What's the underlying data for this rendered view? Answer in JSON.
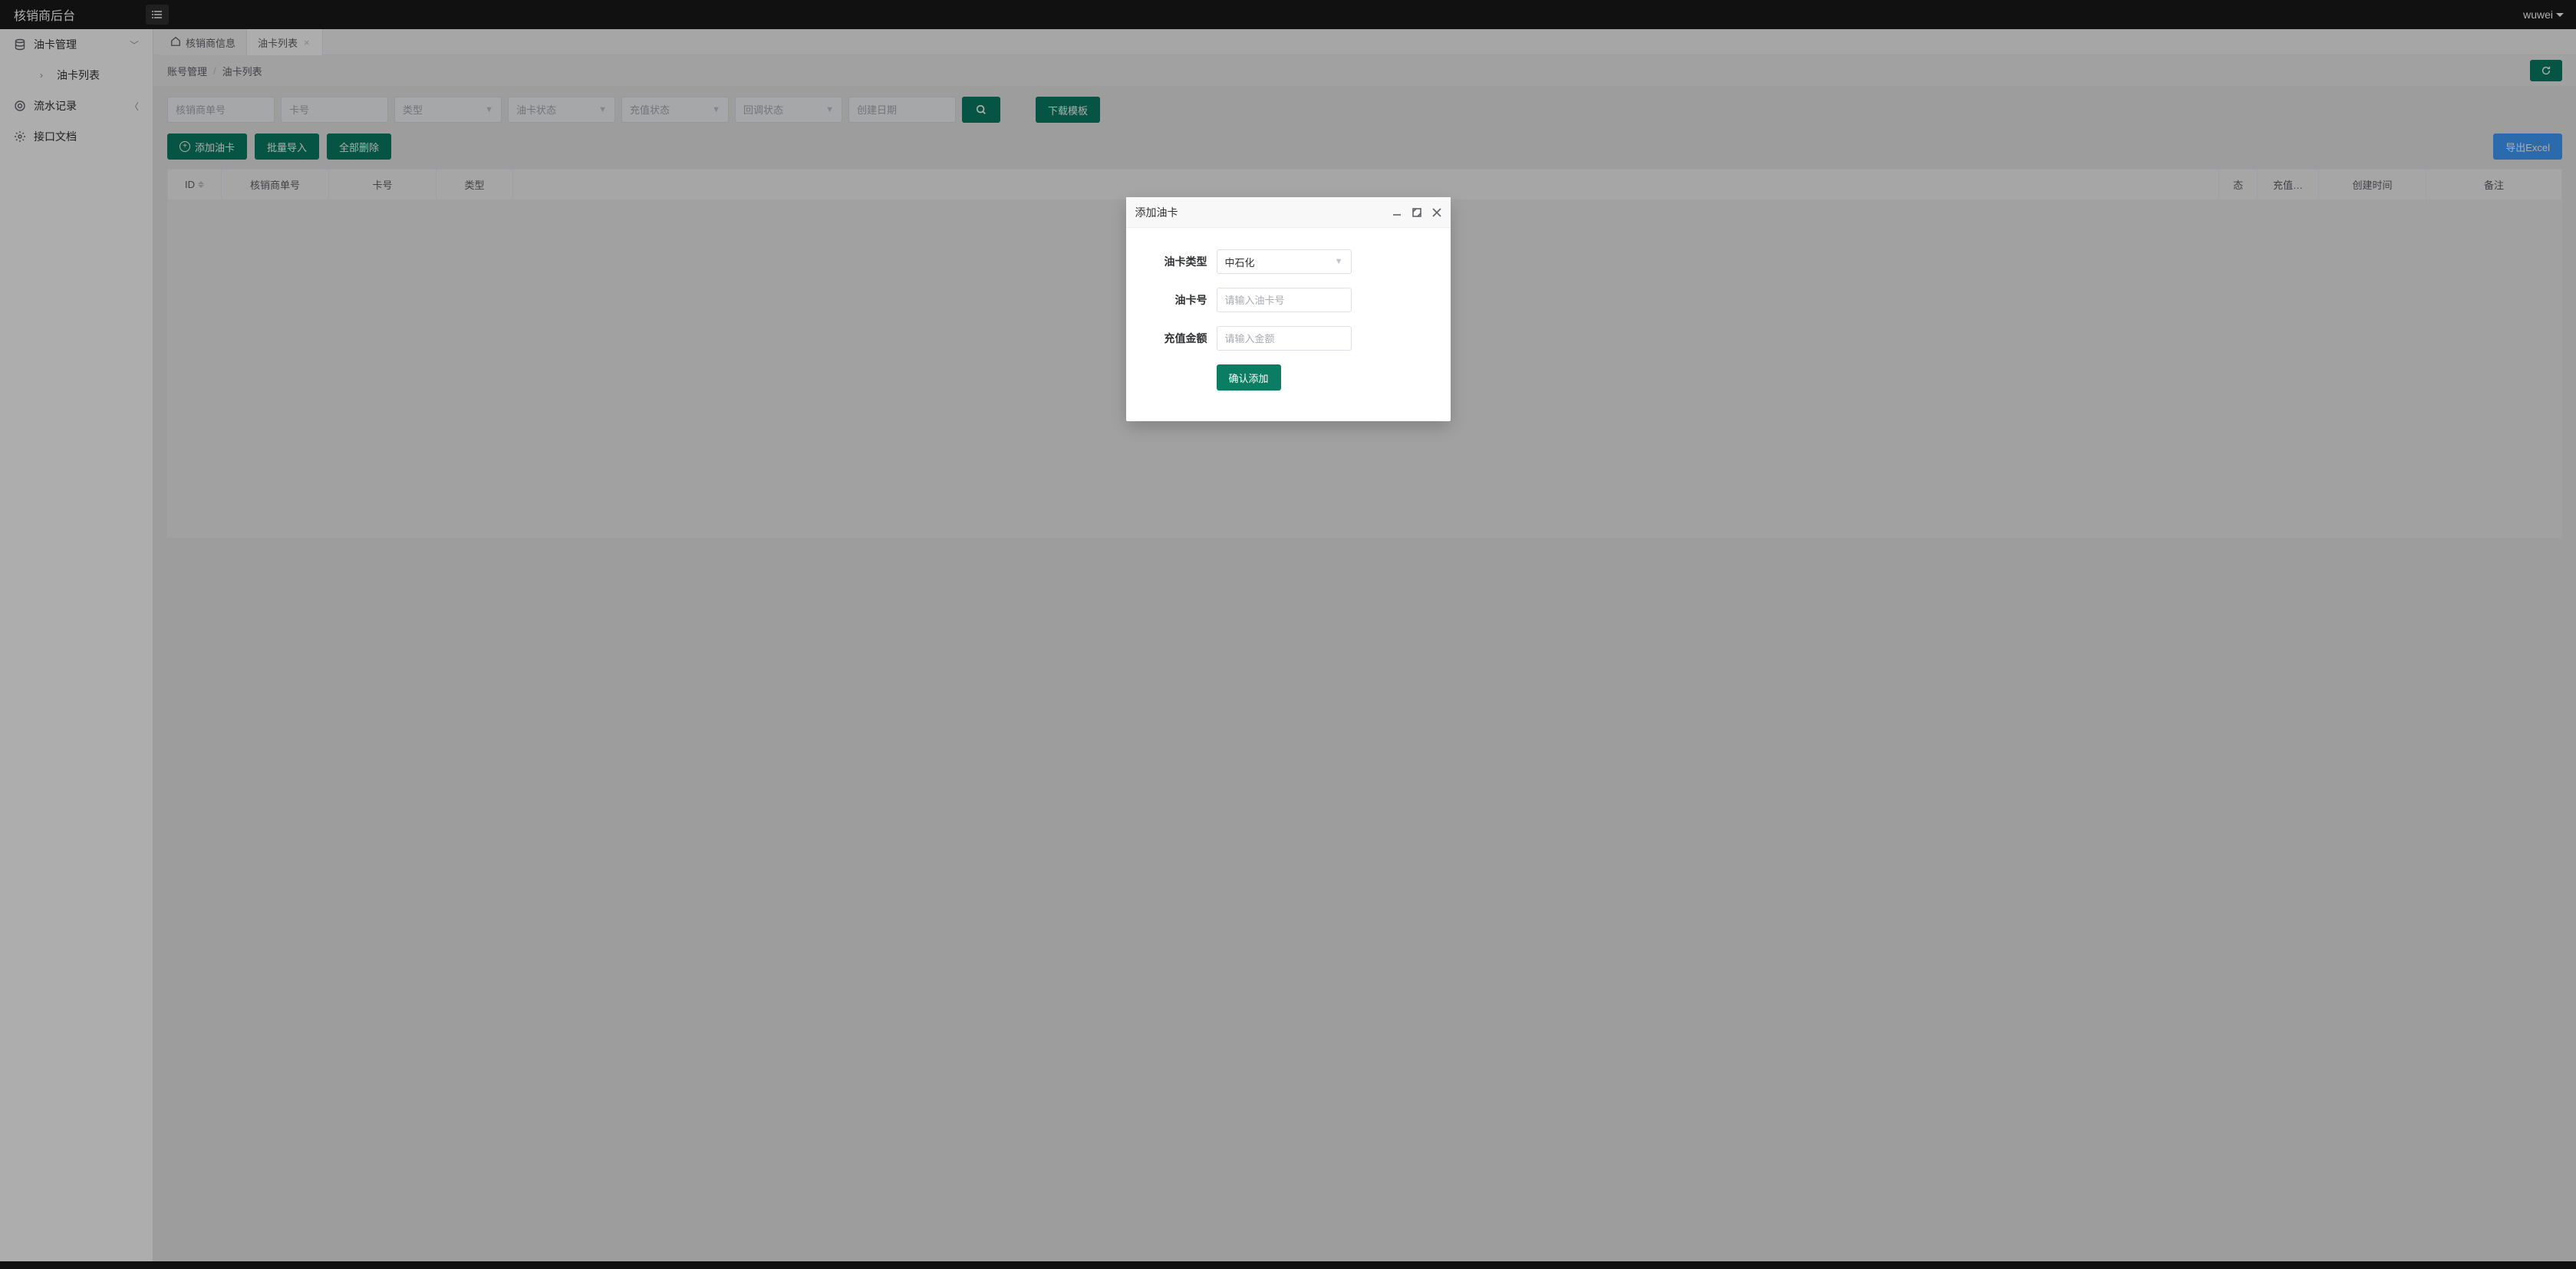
{
  "header": {
    "title": "核销商后台",
    "user": "wuwei"
  },
  "sidebar": {
    "items": [
      {
        "label": "油卡管理",
        "expanded": true,
        "children": [
          {
            "label": "油卡列表"
          }
        ]
      },
      {
        "label": "流水记录"
      },
      {
        "label": "接口文档"
      }
    ]
  },
  "tabs": [
    {
      "label": "核销商信息",
      "closable": false,
      "home": true
    },
    {
      "label": "油卡列表",
      "closable": true,
      "active": true
    }
  ],
  "breadcrumb": {
    "a": "账号管理",
    "b": "油卡列表"
  },
  "filters": {
    "merchant_no": "核销商单号",
    "card_no": "卡号",
    "type": "类型",
    "card_status": "油卡状态",
    "recharge_status": "充值状态",
    "callback_status": "回调状态",
    "create_date": "创建日期"
  },
  "buttons": {
    "download_tpl": "下载模板",
    "add_card": "添加油卡",
    "batch_import": "批量导入",
    "delete_all": "全部删除",
    "export_excel": "导出Excel"
  },
  "table": {
    "columns": [
      "ID",
      "核销商单号",
      "卡号",
      "类型",
      "",
      "态",
      "充值…",
      "创建时间",
      "备注"
    ]
  },
  "modal": {
    "title": "添加油卡",
    "fields": {
      "type_label": "油卡类型",
      "type_value": "中石化",
      "card_label": "油卡号",
      "card_placeholder": "请输入油卡号",
      "amount_label": "充值金额",
      "amount_placeholder": "请输入金额"
    },
    "submit": "确认添加"
  }
}
